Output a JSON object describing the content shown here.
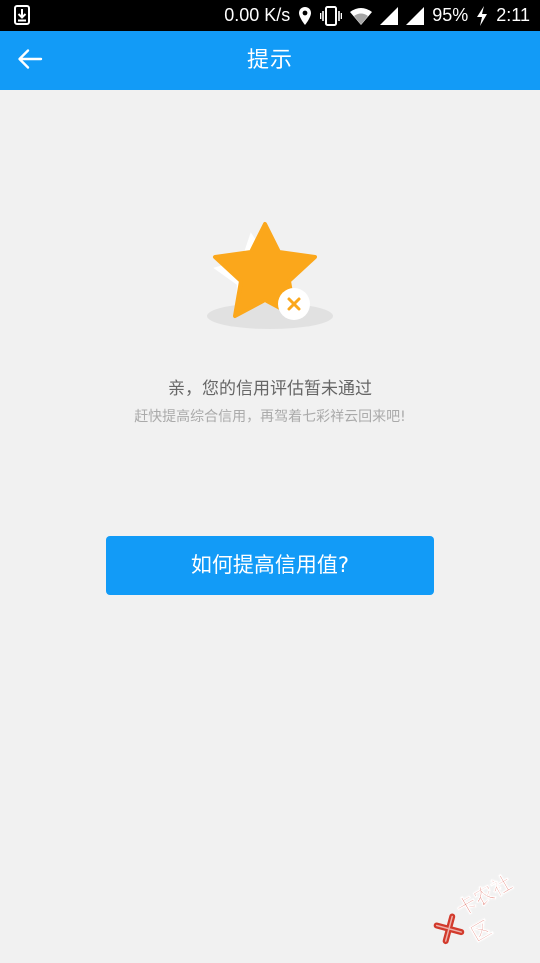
{
  "status_bar": {
    "speed": "0.00 K/s",
    "battery": "95%",
    "time": "2:11"
  },
  "toolbar": {
    "title": "提示"
  },
  "icons": {
    "back": "arrow-left-icon",
    "download": "download-notification-icon",
    "location": "location-pin-icon",
    "vibrate": "vibrate-icon",
    "wifi": "wifi-icon",
    "signal": "signal-icon",
    "charging": "charging-bolt-icon",
    "star": "star-icon",
    "close": "close-icon"
  },
  "message": {
    "headline": "亲，您的信用评估暂未通过",
    "subline": "赶快提高综合信用，再驾着七彩祥云回来吧!"
  },
  "cta": {
    "label": "如何提高信用值?"
  },
  "watermark": {
    "text": "卡农社区"
  },
  "colors": {
    "primary": "#129bf7",
    "background": "#f1f1f1",
    "star": "#fba71b",
    "headline": "#666666",
    "subline": "#aaaaaa"
  }
}
